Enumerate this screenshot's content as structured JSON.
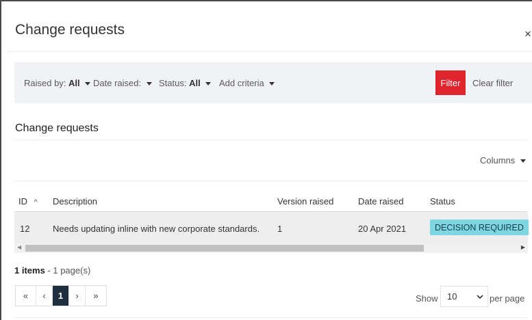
{
  "dialog": {
    "title": "Change requests",
    "close_label": "×"
  },
  "filters": {
    "raised_by_label": "Raised by:",
    "raised_by_value": "All",
    "date_raised_label": "Date raised:",
    "status_label": "Status:",
    "status_value": "All",
    "add_criteria_label": "Add criteria",
    "filter_button": "Filter",
    "clear_filter_button": "Clear filter"
  },
  "section": {
    "title": "Change requests",
    "columns_button": "Columns"
  },
  "table": {
    "headers": {
      "id": "ID",
      "description": "Description",
      "version_raised": "Version raised",
      "date_raised": "Date raised",
      "status": "Status"
    },
    "sort_icon": "^",
    "rows": [
      {
        "id": "12",
        "description": "Needs updating inline with new corporate standards.",
        "version_raised": "1",
        "date_raised": "20 Apr 2021",
        "status": "DECISION REQUIRED"
      }
    ]
  },
  "summary": {
    "items_text": "1 items",
    "pages_text": " - 1 page(s)"
  },
  "pagination": {
    "first": "«",
    "prev": "‹",
    "current": "1",
    "next": "›",
    "last": "»"
  },
  "per_page": {
    "show_label": "Show",
    "value": "10",
    "per_page_label": "per page"
  },
  "colors": {
    "accent_red": "#e0242e",
    "status_badge": "#7fd6e3",
    "active_page": "#1f2f3f"
  },
  "icons": {
    "close": "close-icon",
    "caret": "caret-down-icon",
    "sort": "sort-asc-icon",
    "select": "chevron-down-icon"
  }
}
